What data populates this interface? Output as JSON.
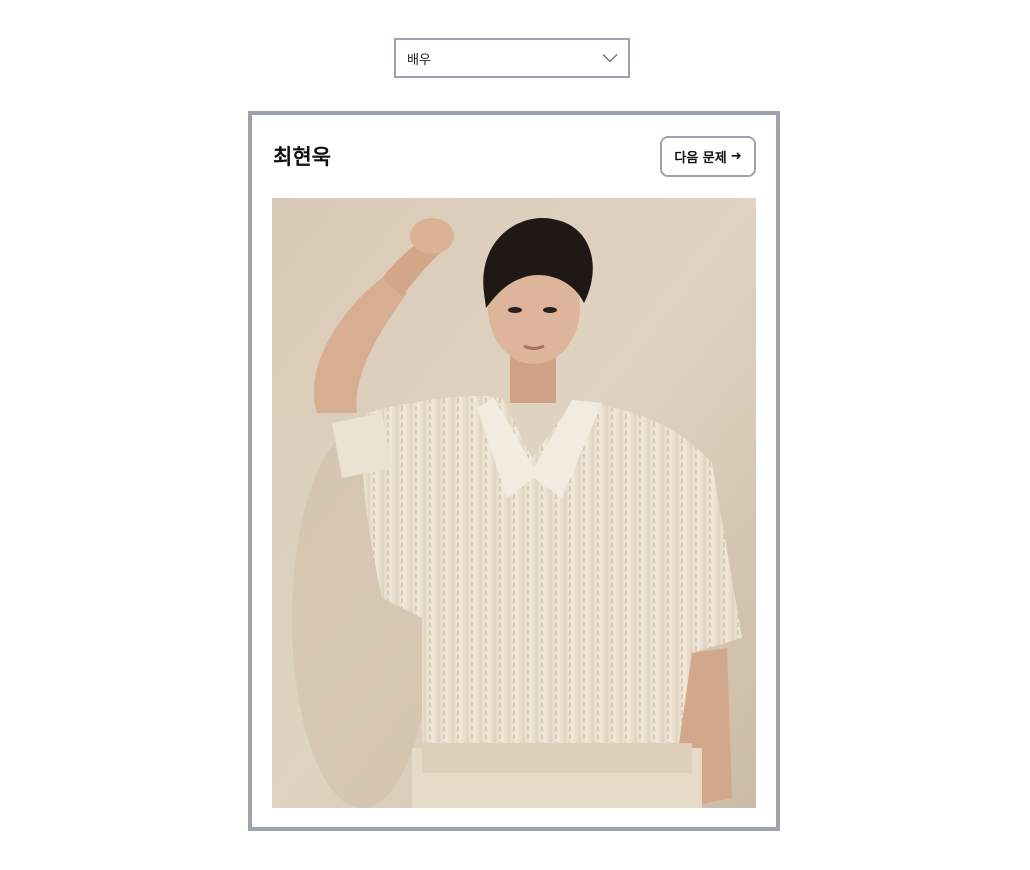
{
  "category_select": {
    "selected": "배우",
    "icon": "chevron-down-icon"
  },
  "quiz_card": {
    "answer_name": "최현욱",
    "next_button": {
      "label": "다음 문제",
      "icon": "arrow-right-icon",
      "icon_glyph": "➜"
    },
    "photo_alt": "최현욱"
  },
  "colors": {
    "border": "#9ca3af",
    "text": "#111111",
    "background": "#ffffff",
    "photo_backdrop": "#d8c9b4"
  }
}
